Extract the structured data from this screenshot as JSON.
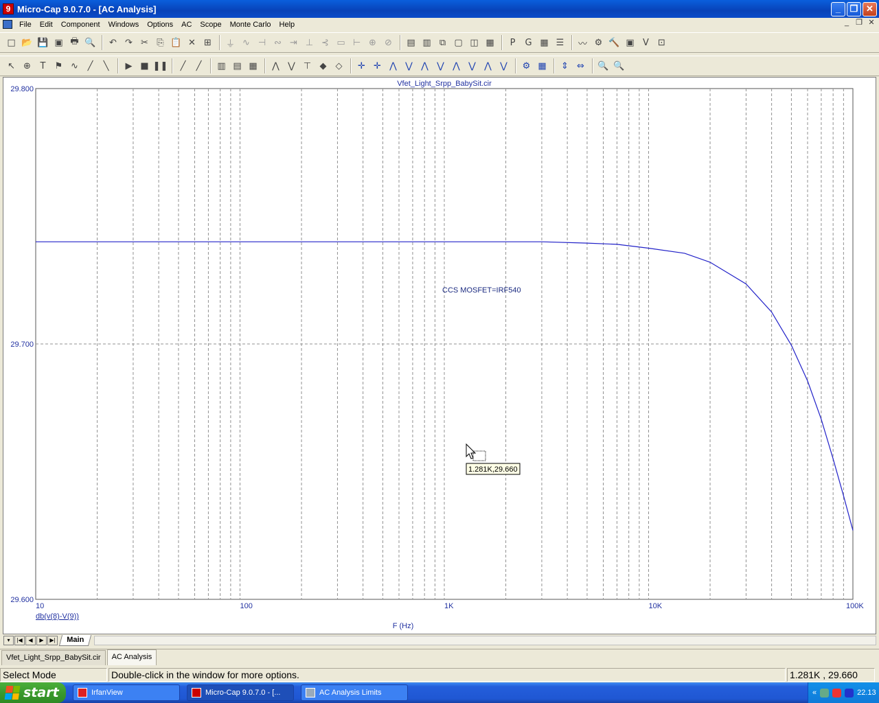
{
  "window": {
    "title": "Micro-Cap 9.0.7.0 - [AC Analysis]",
    "app_icon": "9"
  },
  "menu": [
    "File",
    "Edit",
    "Component",
    "Windows",
    "Options",
    "AC",
    "Scope",
    "Monte Carlo",
    "Help"
  ],
  "toolbar1_icons": [
    "new-file-icon",
    "open-icon",
    "save-icon",
    "save-all-icon",
    "print-icon",
    "print-preview-icon",
    "undo-icon",
    "redo-icon",
    "cut-icon",
    "copy-icon",
    "paste-icon",
    "delete-icon",
    "select-all-icon",
    "ground-icon",
    "resistor-icon",
    "capacitor-icon",
    "inductor-icon",
    "diode-icon",
    "battery-icon",
    "npn-icon",
    "gate-icon",
    "bus-icon",
    "node-icon",
    "probe-icon",
    "tile-horizontal-icon",
    "tile-vertical-icon",
    "cascade-icon",
    "window-icon",
    "split-window-icon",
    "calculator-icon",
    "p-icon",
    "g-icon",
    "grid-icon",
    "properties-icon",
    "waveform-icon",
    "component-finder-icon",
    "hammer-icon",
    "scope-icon",
    "vd-icon",
    "graph-icon"
  ],
  "toolbar1_glyphs": [
    "□",
    "📂",
    "💾",
    "▣",
    "🖶",
    "🔍",
    "↶",
    "↷",
    "✂",
    "⎘",
    "📋",
    "✕",
    "⊞",
    "⏚",
    "∿",
    "⊣",
    "∾",
    "⇥",
    "⊥",
    "⊰",
    "▭",
    "⊢",
    "⊕",
    "⊘",
    "▤",
    "▥",
    "⧉",
    "▢",
    "◫",
    "▦",
    "P",
    "G",
    "▦",
    "☰",
    "〰",
    "⚙",
    "🔨",
    "▣",
    "V",
    "⊡"
  ],
  "toolbar2_icons": [
    "select-arrow-icon",
    "component-icon",
    "text-icon",
    "flag-icon",
    "wire-icon",
    "diag-wire-icon",
    "bus-wire-icon",
    "run-icon",
    "stop-icon",
    "pause-icon",
    "line-icon",
    "cursor-line-icon",
    "grid-on-icon",
    "grid-off-icon",
    "grid-table-icon",
    "peak-icon",
    "valley-icon",
    "high-icon",
    "data-point-icon",
    "tag-icon",
    "cursor-left-icon",
    "cursor-right-icon",
    "slope-icon",
    "peak-cursor-icon",
    "valley-cursor-icon",
    "high-cursor-icon",
    "low-cursor-icon",
    "inflection-icon",
    "global-high-icon",
    "global-low-icon",
    "mode-icon",
    "table-icon",
    "scale-icon",
    "autoscale-icon",
    "zoom-in-icon",
    "zoom-out-icon"
  ],
  "toolbar2_glyphs": [
    "↖",
    "⊕",
    "T",
    "⚑",
    "∿",
    "╱",
    "╲",
    "▶",
    "■",
    "❚❚",
    "╱",
    "╱",
    "▥",
    "▤",
    "▦",
    "⋀",
    "⋁",
    "⊤",
    "◆",
    "◇",
    "✛",
    "✛",
    "⋀",
    "⋁",
    "⋀",
    "⋁",
    "⋀",
    "⋁",
    "⋀",
    "⋁",
    "⚙",
    "▦",
    "⇕",
    "⇔",
    "🔍",
    "🔍"
  ],
  "plot": {
    "title": "Vfet_Light_Srpp_BabySit.cir",
    "annotation": "CCS MOSFET=IRF540",
    "y_ticks": [
      "29.800",
      "29.700",
      "29.600"
    ],
    "x_ticks": [
      "10",
      "100",
      "1K",
      "10K",
      "100K"
    ],
    "trace_label": "db(v(8)-V(9))",
    "x_axis_label": "F (Hz)",
    "cursor_tooltip": "1.281K,29.660",
    "trace_color": "#2020c8",
    "label_color": "#2030a0"
  },
  "chart_data": {
    "type": "line",
    "title": "Vfet_Light_Srpp_BabySit.cir",
    "xlabel": "F (Hz)",
    "ylabel": "",
    "xscale": "log",
    "xlim": [
      10,
      100000
    ],
    "ylim": [
      29.6,
      29.8
    ],
    "grid": true,
    "series": [
      {
        "name": "db(v(8)-V(9))",
        "x": [
          10,
          100,
          1000,
          3000,
          5000,
          7000,
          10000,
          15000,
          20000,
          30000,
          40000,
          50000,
          60000,
          70000,
          80000,
          90000,
          100000
        ],
        "y": [
          29.74,
          29.74,
          29.74,
          29.74,
          29.7395,
          29.739,
          29.7375,
          29.7355,
          29.732,
          29.7235,
          29.7125,
          29.6995,
          29.6855,
          29.6705,
          29.655,
          29.6405,
          29.627
        ]
      }
    ],
    "annotations": [
      "CCS MOSFET=IRF540"
    ]
  },
  "sheet_tabs": {
    "active": "Main"
  },
  "doc_tabs": [
    "Vfet_Light_Srpp_BabySit.cir",
    "AC Analysis"
  ],
  "status": {
    "mode": "Select Mode",
    "hint": "Double-click in the window for more options.",
    "coords": "1.281K , 29.660"
  },
  "taskbar": {
    "start_label": "start",
    "tasks": [
      "IrfanView",
      "Micro-Cap 9.0.7.0 - [...",
      "AC Analysis Limits"
    ],
    "clock": "22.13"
  }
}
